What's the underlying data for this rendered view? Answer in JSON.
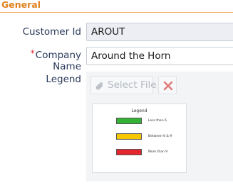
{
  "section": {
    "title": "General"
  },
  "form": {
    "customer_id": {
      "label": "Customer Id",
      "value": "AROUT"
    },
    "company_name": {
      "label": "Company Name",
      "required_mark": "*",
      "value": "Around the Horn"
    },
    "legend": {
      "label": "Legend",
      "select_file_label": "Select File",
      "preview": {
        "title": "Legend",
        "items": [
          {
            "label": "Less than 6",
            "color": "#34b233"
          },
          {
            "label": "Between 6 & 9",
            "color": "#f6c700"
          },
          {
            "label": "More than 9",
            "color": "#e3262e"
          }
        ]
      }
    }
  },
  "icons": {
    "select_file": "paperclip-icon",
    "delete": "close-icon"
  },
  "colors": {
    "section_title": "#e0821e",
    "section_rule": "#f0b060",
    "required": "#d9262c",
    "delete_icon": "#e07a7a"
  }
}
